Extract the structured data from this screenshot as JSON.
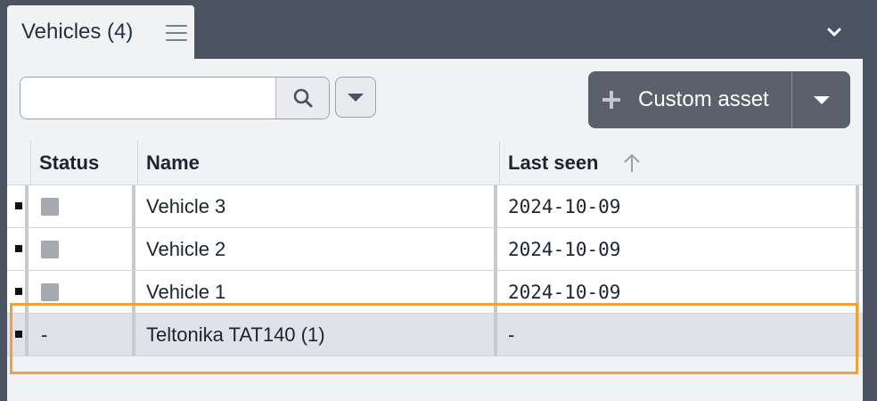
{
  "tab": {
    "title": "Vehicles (4)"
  },
  "search": {
    "value": "",
    "placeholder": ""
  },
  "toolbar": {
    "custom_asset_label": "Custom asset"
  },
  "table": {
    "columns": [
      "Status",
      "Name",
      "Last seen"
    ],
    "sort": {
      "column": "Last seen",
      "direction": "ascending"
    },
    "rows": [
      {
        "status": "",
        "name": "Vehicle 3",
        "last_seen": "2024-10-09"
      },
      {
        "status": "",
        "name": "Vehicle 2",
        "last_seen": "2024-10-09"
      },
      {
        "status": "",
        "name": "Vehicle 1",
        "last_seen": "2024-10-09"
      },
      {
        "status": "-",
        "name": "Teltonika TAT140 (1)",
        "last_seen": "-"
      }
    ]
  },
  "colors": {
    "background": "#4b5260",
    "panel": "#f1f2f4",
    "button_dark": "#5a606c",
    "highlight": "#f0a03c",
    "selected_row": "#dfe2e8"
  },
  "icons": [
    "menu-icon",
    "chevron-down-icon",
    "search-icon",
    "caret-down-icon",
    "plus-icon",
    "sort-up-icon"
  ]
}
